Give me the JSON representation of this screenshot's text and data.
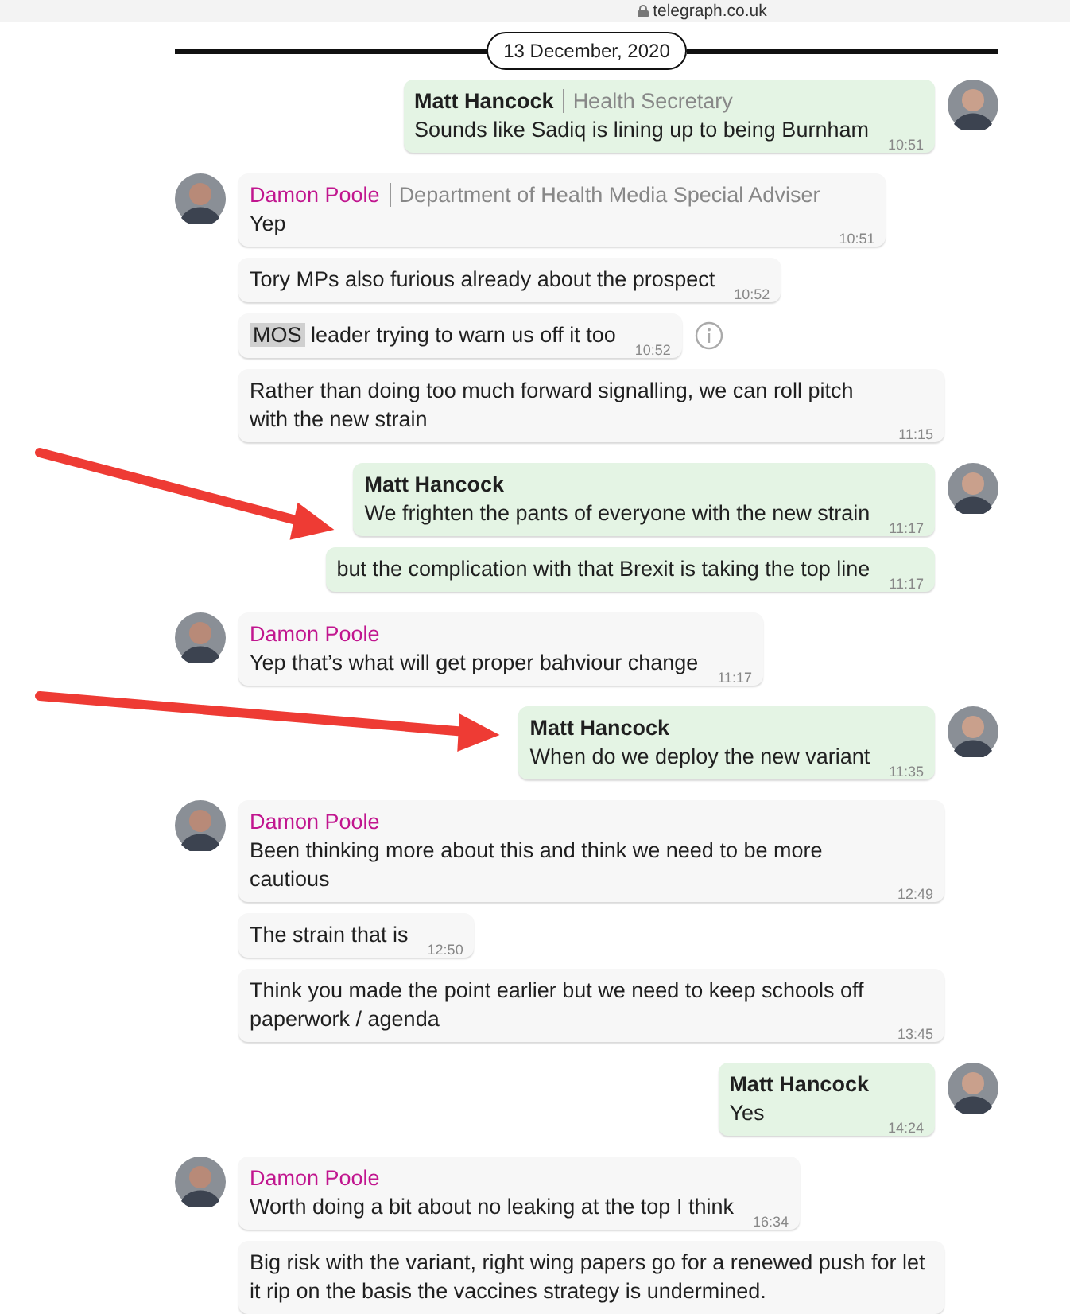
{
  "address_bar": {
    "url": "telegraph.co.uk"
  },
  "date_divider": "13 December, 2020",
  "messages": [
    {
      "kind": "out",
      "sender": "Matt Hancock",
      "role": "Health Secretary",
      "avatar": true,
      "text": "Sounds like Sadiq is lining up to being Burnham",
      "time": "10:51"
    },
    {
      "kind": "in",
      "sender": "Damon Poole",
      "role": "Department of Health Media Special Adviser",
      "avatar": true,
      "text": "Yep",
      "time": "10:51"
    },
    {
      "kind": "in",
      "text": "Tory MPs also furious already about the prospect",
      "time": "10:52"
    },
    {
      "kind": "in",
      "highlight": "MOS",
      "text": "leader trying to warn us off it too",
      "time": "10:52",
      "info": true
    },
    {
      "kind": "in",
      "text": "Rather than doing too much forward signalling, we can roll pitch with the new strain",
      "time": "11:15"
    },
    {
      "kind": "out",
      "sender": "Matt Hancock",
      "avatar": true,
      "text": "We frighten the pants of everyone with the new strain",
      "time": "11:17",
      "arrow": true
    },
    {
      "kind": "out",
      "text": "but the complication with that Brexit is taking the top line",
      "time": "11:17"
    },
    {
      "kind": "in",
      "sender": "Damon Poole",
      "avatar": true,
      "text": "Yep that’s what will get proper bahviour change",
      "time": "11:17"
    },
    {
      "kind": "out",
      "sender": "Matt Hancock",
      "avatar": true,
      "text": "When do we deploy the new variant",
      "time": "11:35",
      "arrow": true
    },
    {
      "kind": "in",
      "sender": "Damon Poole",
      "avatar": true,
      "text": "Been thinking more about this and think we need to be more cautious",
      "time": "12:49"
    },
    {
      "kind": "in",
      "text": "The strain that is",
      "time": "12:50"
    },
    {
      "kind": "in",
      "text": "Think you made the point earlier but we need to keep schools off paperwork / agenda",
      "time": "13:45"
    },
    {
      "kind": "out",
      "sender": "Matt Hancock",
      "avatar": true,
      "text": "Yes",
      "time": "14:24"
    },
    {
      "kind": "in",
      "sender": "Damon Poole",
      "avatar": true,
      "text": "Worth doing a bit about no leaking at the top I think",
      "time": "16:34"
    },
    {
      "kind": "in",
      "text": "Big risk with the variant, right wing papers go for a renewed push for let it rip on the basis the vaccines strategy is undermined."
    }
  ]
}
